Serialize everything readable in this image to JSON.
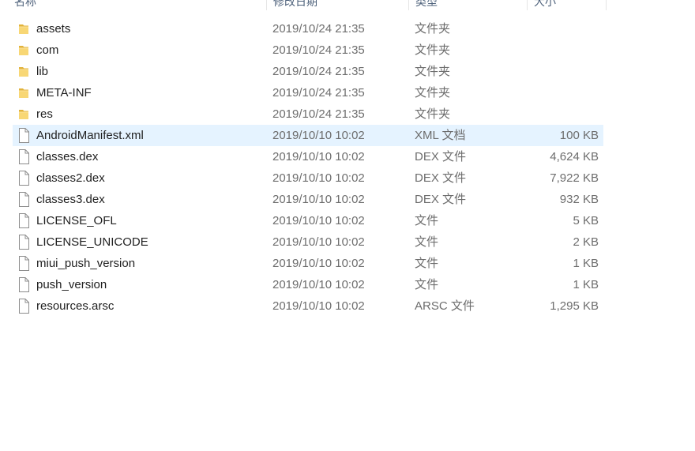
{
  "header": {
    "columns": [
      "名称",
      "修改日期",
      "类型",
      "大小"
    ]
  },
  "colors": {
    "folder_yellow": "#f8d775",
    "folder_dark": "#e2b33b",
    "selection_bg": "#e5f3ff",
    "meta_text": "#6d6d6d"
  },
  "files": [
    {
      "name": "assets",
      "date": "2019/10/24 21:35",
      "type": "文件夹",
      "size": "",
      "icon": "folder-icon"
    },
    {
      "name": "com",
      "date": "2019/10/24 21:35",
      "type": "文件夹",
      "size": "",
      "icon": "folder-icon"
    },
    {
      "name": "lib",
      "date": "2019/10/24 21:35",
      "type": "文件夹",
      "size": "",
      "icon": "folder-icon"
    },
    {
      "name": "META-INF",
      "date": "2019/10/24 21:35",
      "type": "文件夹",
      "size": "",
      "icon": "folder-icon"
    },
    {
      "name": "res",
      "date": "2019/10/24 21:35",
      "type": "文件夹",
      "size": "",
      "icon": "folder-icon"
    },
    {
      "name": "AndroidManifest.xml",
      "date": "2019/10/10 10:02",
      "type": "XML 文档",
      "size": "100 KB",
      "icon": "file-icon",
      "selected": true
    },
    {
      "name": "classes.dex",
      "date": "2019/10/10 10:02",
      "type": "DEX 文件",
      "size": "4,624 KB",
      "icon": "file-icon"
    },
    {
      "name": "classes2.dex",
      "date": "2019/10/10 10:02",
      "type": "DEX 文件",
      "size": "7,922 KB",
      "icon": "file-icon"
    },
    {
      "name": "classes3.dex",
      "date": "2019/10/10 10:02",
      "type": "DEX 文件",
      "size": "932 KB",
      "icon": "file-icon"
    },
    {
      "name": "LICENSE_OFL",
      "date": "2019/10/10 10:02",
      "type": "文件",
      "size": "5 KB",
      "icon": "file-icon"
    },
    {
      "name": "LICENSE_UNICODE",
      "date": "2019/10/10 10:02",
      "type": "文件",
      "size": "2 KB",
      "icon": "file-icon"
    },
    {
      "name": "miui_push_version",
      "date": "2019/10/10 10:02",
      "type": "文件",
      "size": "1 KB",
      "icon": "file-icon"
    },
    {
      "name": "push_version",
      "date": "2019/10/10 10:02",
      "type": "文件",
      "size": "1 KB",
      "icon": "file-icon"
    },
    {
      "name": "resources.arsc",
      "date": "2019/10/10 10:02",
      "type": "ARSC 文件",
      "size": "1,295 KB",
      "icon": "file-icon"
    }
  ]
}
